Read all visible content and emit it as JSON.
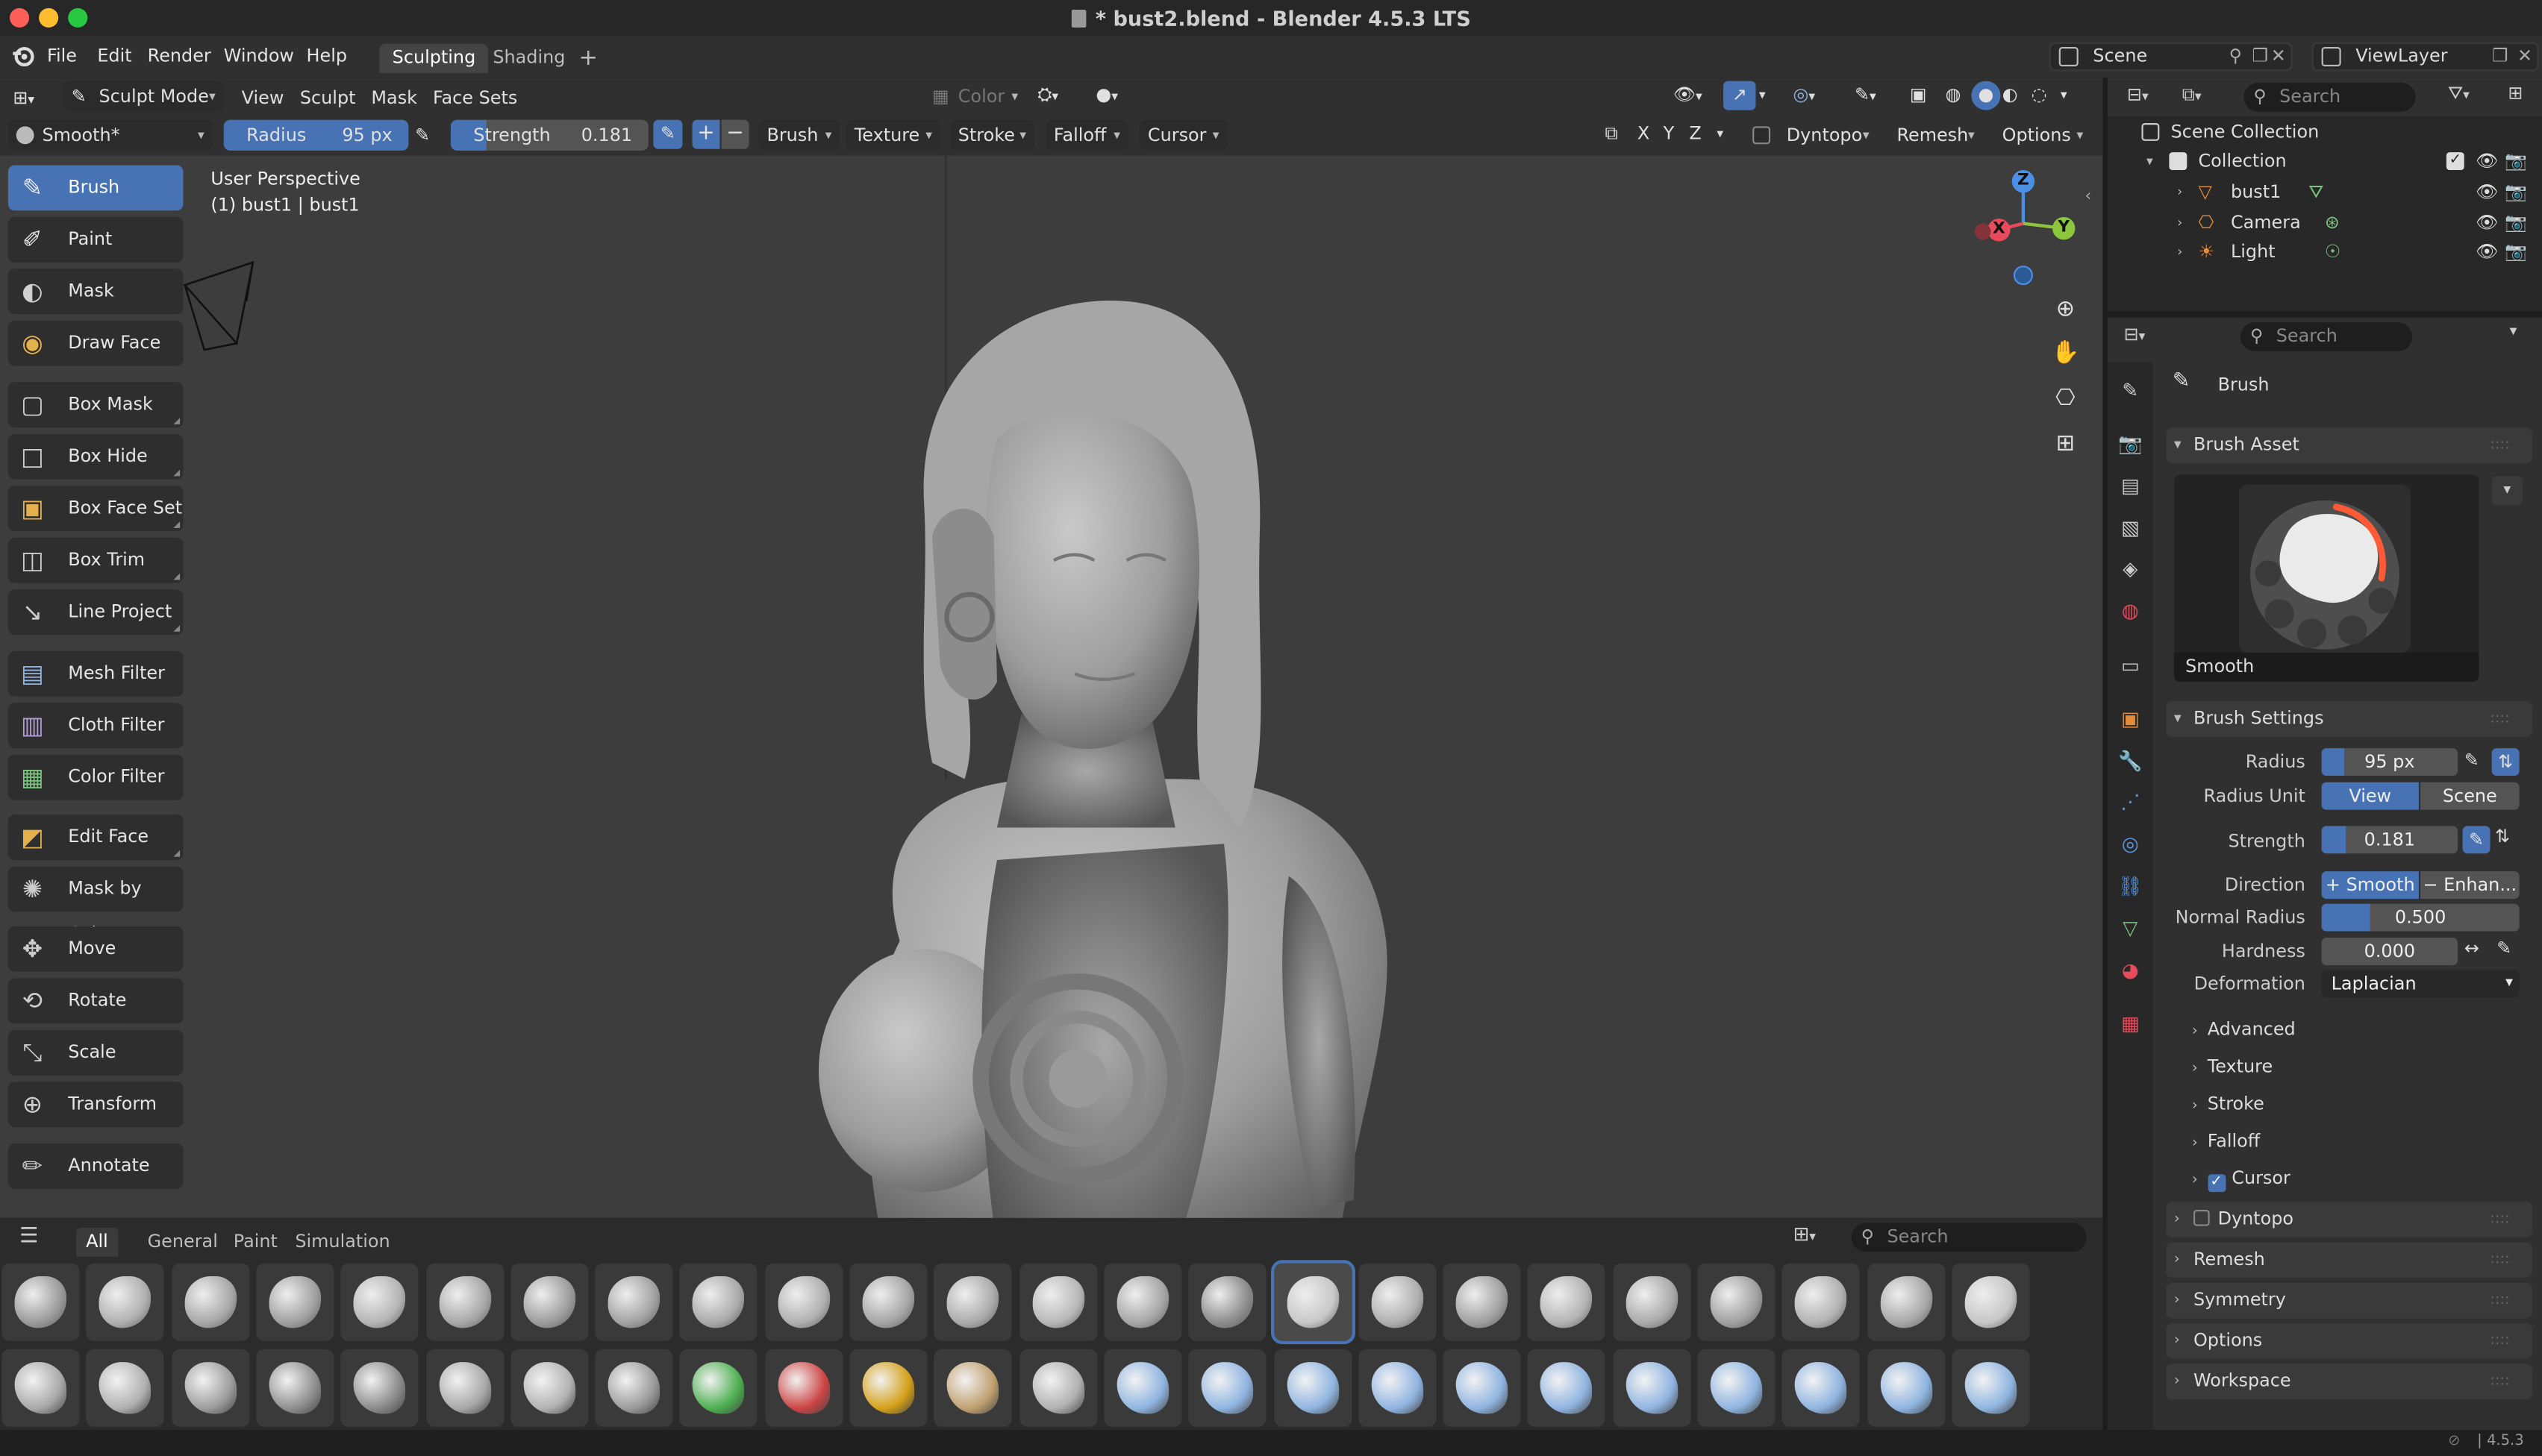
{
  "window": {
    "title": "* bust2.blend - Blender 4.5.3 LTS"
  },
  "menu": {
    "file": "File",
    "edit": "Edit",
    "render": "Render",
    "window": "Window",
    "help": "Help"
  },
  "workspaces": [
    {
      "label": "Sculpting",
      "active": true
    },
    {
      "label": "Shading",
      "active": false
    }
  ],
  "scene": {
    "label": "Scene",
    "viewlayer": "ViewLayer"
  },
  "viewport_header": {
    "mode": "Sculpt Mode",
    "view": "View",
    "sculpt": "Sculpt",
    "mask": "Mask",
    "face_sets": "Face Sets",
    "color": "Color"
  },
  "tool_header": {
    "brush_name": "Smooth*",
    "radius_label": "Radius",
    "radius_value": "95 px",
    "strength_label": "Strength",
    "strength_value": "0.181",
    "brush": "Brush",
    "texture": "Texture",
    "stroke": "Stroke",
    "falloff": "Falloff",
    "cursor": "Cursor",
    "x": "X",
    "y": "Y",
    "z": "Z",
    "dyntopo": "Dyntopo",
    "remesh": "Remesh",
    "options": "Options"
  },
  "viewport": {
    "perspective": "User Perspective",
    "object": "(1) bust1 | bust1"
  },
  "gizmo": {
    "x": "X",
    "y": "Y",
    "z": "Z"
  },
  "tools": [
    {
      "label": "Brush",
      "active": true,
      "icon": "brush-icon",
      "color": "#e8e8e8"
    },
    {
      "label": "Paint",
      "active": false,
      "icon": "paint-icon",
      "color": "#e8e8e8"
    },
    {
      "label": "Mask",
      "active": false,
      "icon": "mask-icon",
      "color": "#d0d0d0"
    },
    {
      "label": "Draw Face ...",
      "active": false,
      "icon": "face-set-icon",
      "color": "#e3b04b"
    },
    {
      "label": "Box Mask",
      "active": false,
      "icon": "box-mask-icon",
      "color": "#cccccc"
    },
    {
      "label": "Box Hide",
      "active": false,
      "icon": "box-hide-icon",
      "color": "#cccccc"
    },
    {
      "label": "Box Face Set",
      "active": false,
      "icon": "box-face-set-icon",
      "color": "#e3b04b"
    },
    {
      "label": "Box Trim",
      "active": false,
      "icon": "box-trim-icon",
      "color": "#cccccc"
    },
    {
      "label": "Line Project",
      "active": false,
      "icon": "line-project-icon",
      "color": "#cccccc"
    },
    {
      "label": "Mesh Filter",
      "active": false,
      "icon": "mesh-filter-icon",
      "color": "#8fb4e0"
    },
    {
      "label": "Cloth Filter",
      "active": false,
      "icon": "cloth-filter-icon",
      "color": "#b39ddb"
    },
    {
      "label": "Color Filter",
      "active": false,
      "icon": "color-filter-icon",
      "color": "#7cc47f"
    },
    {
      "label": "Edit Face Set",
      "active": false,
      "icon": "edit-face-set-icon",
      "color": "#e3b04b"
    },
    {
      "label": "Mask by Col...",
      "active": false,
      "icon": "mask-by-color-icon",
      "color": "#cccccc"
    },
    {
      "label": "Move",
      "active": false,
      "icon": "move-icon",
      "color": "#cccccc"
    },
    {
      "label": "Rotate",
      "active": false,
      "icon": "rotate-icon",
      "color": "#cccccc"
    },
    {
      "label": "Scale",
      "active": false,
      "icon": "scale-icon",
      "color": "#cccccc"
    },
    {
      "label": "Transform",
      "active": false,
      "icon": "transform-icon",
      "color": "#cccccc"
    },
    {
      "label": "Annotate",
      "active": false,
      "icon": "annotate-icon",
      "color": "#cccccc"
    }
  ],
  "shelf": {
    "tabs": [
      {
        "label": "All",
        "active": true
      },
      {
        "label": "General",
        "active": false
      },
      {
        "label": "Paint",
        "active": false
      },
      {
        "label": "Simulation",
        "active": false
      }
    ],
    "search_placeholder": "Search"
  },
  "outliner": {
    "search_placeholder": "Search",
    "scene_collection": "Scene Collection",
    "collection": "Collection",
    "items": [
      {
        "label": "bust1"
      },
      {
        "label": "Camera"
      },
      {
        "label": "Light"
      }
    ]
  },
  "properties": {
    "search_placeholder": "Search",
    "brush_title": "Brush",
    "brush_asset": "Brush Asset",
    "asset_name": "Smooth",
    "brush_settings": "Brush Settings",
    "radius_label": "Radius",
    "radius_value": "95 px",
    "radius_unit_label": "Radius Unit",
    "unit_view": "View",
    "unit_scene": "Scene",
    "strength_label": "Strength",
    "strength_value": "0.181",
    "direction_label": "Direction",
    "dir_smooth": "Smooth",
    "dir_enhance": "Enhan...",
    "normal_radius_label": "Normal Radius",
    "normal_radius_value": "0.500",
    "hardness_label": "Hardness",
    "hardness_value": "0.000",
    "deformation_label": "Deformation",
    "deformation_value": "Laplacian",
    "subpanels": [
      "Advanced",
      "Texture",
      "Stroke",
      "Falloff",
      "Cursor"
    ],
    "panels": [
      "Dyntopo",
      "Remesh",
      "Symmetry",
      "Options",
      "Workspace"
    ]
  },
  "status": {
    "version": "4.5.3"
  },
  "colors": {
    "accent": "#4772b3",
    "bg": "#1d1d1d",
    "panel": "#303030",
    "viewport": "#3d3d3d"
  }
}
